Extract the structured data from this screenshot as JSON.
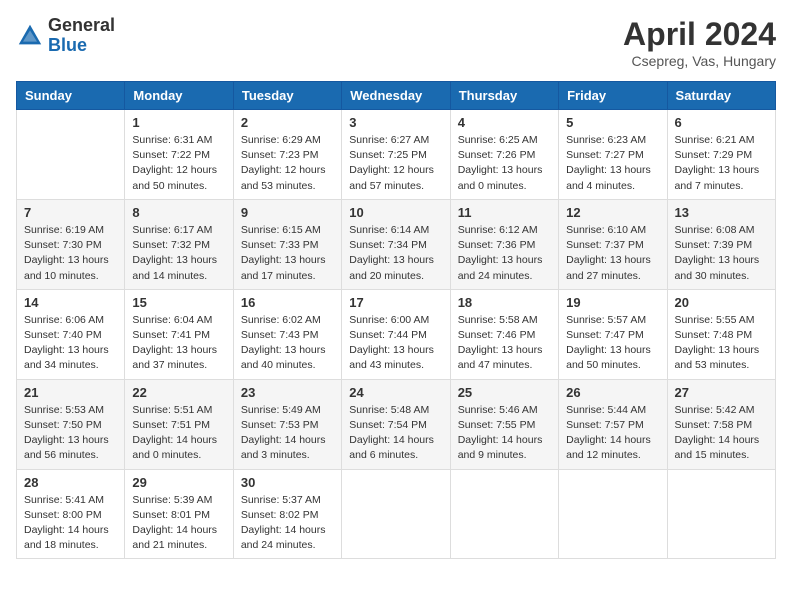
{
  "logo": {
    "general": "General",
    "blue": "Blue"
  },
  "title": "April 2024",
  "location": "Csepreg, Vas, Hungary",
  "days_of_week": [
    "Sunday",
    "Monday",
    "Tuesday",
    "Wednesday",
    "Thursday",
    "Friday",
    "Saturday"
  ],
  "weeks": [
    [
      {
        "day": "",
        "info": ""
      },
      {
        "day": "1",
        "info": "Sunrise: 6:31 AM\nSunset: 7:22 PM\nDaylight: 12 hours\nand 50 minutes."
      },
      {
        "day": "2",
        "info": "Sunrise: 6:29 AM\nSunset: 7:23 PM\nDaylight: 12 hours\nand 53 minutes."
      },
      {
        "day": "3",
        "info": "Sunrise: 6:27 AM\nSunset: 7:25 PM\nDaylight: 12 hours\nand 57 minutes."
      },
      {
        "day": "4",
        "info": "Sunrise: 6:25 AM\nSunset: 7:26 PM\nDaylight: 13 hours\nand 0 minutes."
      },
      {
        "day": "5",
        "info": "Sunrise: 6:23 AM\nSunset: 7:27 PM\nDaylight: 13 hours\nand 4 minutes."
      },
      {
        "day": "6",
        "info": "Sunrise: 6:21 AM\nSunset: 7:29 PM\nDaylight: 13 hours\nand 7 minutes."
      }
    ],
    [
      {
        "day": "7",
        "info": "Sunrise: 6:19 AM\nSunset: 7:30 PM\nDaylight: 13 hours\nand 10 minutes."
      },
      {
        "day": "8",
        "info": "Sunrise: 6:17 AM\nSunset: 7:32 PM\nDaylight: 13 hours\nand 14 minutes."
      },
      {
        "day": "9",
        "info": "Sunrise: 6:15 AM\nSunset: 7:33 PM\nDaylight: 13 hours\nand 17 minutes."
      },
      {
        "day": "10",
        "info": "Sunrise: 6:14 AM\nSunset: 7:34 PM\nDaylight: 13 hours\nand 20 minutes."
      },
      {
        "day": "11",
        "info": "Sunrise: 6:12 AM\nSunset: 7:36 PM\nDaylight: 13 hours\nand 24 minutes."
      },
      {
        "day": "12",
        "info": "Sunrise: 6:10 AM\nSunset: 7:37 PM\nDaylight: 13 hours\nand 27 minutes."
      },
      {
        "day": "13",
        "info": "Sunrise: 6:08 AM\nSunset: 7:39 PM\nDaylight: 13 hours\nand 30 minutes."
      }
    ],
    [
      {
        "day": "14",
        "info": "Sunrise: 6:06 AM\nSunset: 7:40 PM\nDaylight: 13 hours\nand 34 minutes."
      },
      {
        "day": "15",
        "info": "Sunrise: 6:04 AM\nSunset: 7:41 PM\nDaylight: 13 hours\nand 37 minutes."
      },
      {
        "day": "16",
        "info": "Sunrise: 6:02 AM\nSunset: 7:43 PM\nDaylight: 13 hours\nand 40 minutes."
      },
      {
        "day": "17",
        "info": "Sunrise: 6:00 AM\nSunset: 7:44 PM\nDaylight: 13 hours\nand 43 minutes."
      },
      {
        "day": "18",
        "info": "Sunrise: 5:58 AM\nSunset: 7:46 PM\nDaylight: 13 hours\nand 47 minutes."
      },
      {
        "day": "19",
        "info": "Sunrise: 5:57 AM\nSunset: 7:47 PM\nDaylight: 13 hours\nand 50 minutes."
      },
      {
        "day": "20",
        "info": "Sunrise: 5:55 AM\nSunset: 7:48 PM\nDaylight: 13 hours\nand 53 minutes."
      }
    ],
    [
      {
        "day": "21",
        "info": "Sunrise: 5:53 AM\nSunset: 7:50 PM\nDaylight: 13 hours\nand 56 minutes."
      },
      {
        "day": "22",
        "info": "Sunrise: 5:51 AM\nSunset: 7:51 PM\nDaylight: 14 hours\nand 0 minutes."
      },
      {
        "day": "23",
        "info": "Sunrise: 5:49 AM\nSunset: 7:53 PM\nDaylight: 14 hours\nand 3 minutes."
      },
      {
        "day": "24",
        "info": "Sunrise: 5:48 AM\nSunset: 7:54 PM\nDaylight: 14 hours\nand 6 minutes."
      },
      {
        "day": "25",
        "info": "Sunrise: 5:46 AM\nSunset: 7:55 PM\nDaylight: 14 hours\nand 9 minutes."
      },
      {
        "day": "26",
        "info": "Sunrise: 5:44 AM\nSunset: 7:57 PM\nDaylight: 14 hours\nand 12 minutes."
      },
      {
        "day": "27",
        "info": "Sunrise: 5:42 AM\nSunset: 7:58 PM\nDaylight: 14 hours\nand 15 minutes."
      }
    ],
    [
      {
        "day": "28",
        "info": "Sunrise: 5:41 AM\nSunset: 8:00 PM\nDaylight: 14 hours\nand 18 minutes."
      },
      {
        "day": "29",
        "info": "Sunrise: 5:39 AM\nSunset: 8:01 PM\nDaylight: 14 hours\nand 21 minutes."
      },
      {
        "day": "30",
        "info": "Sunrise: 5:37 AM\nSunset: 8:02 PM\nDaylight: 14 hours\nand 24 minutes."
      },
      {
        "day": "",
        "info": ""
      },
      {
        "day": "",
        "info": ""
      },
      {
        "day": "",
        "info": ""
      },
      {
        "day": "",
        "info": ""
      }
    ]
  ]
}
